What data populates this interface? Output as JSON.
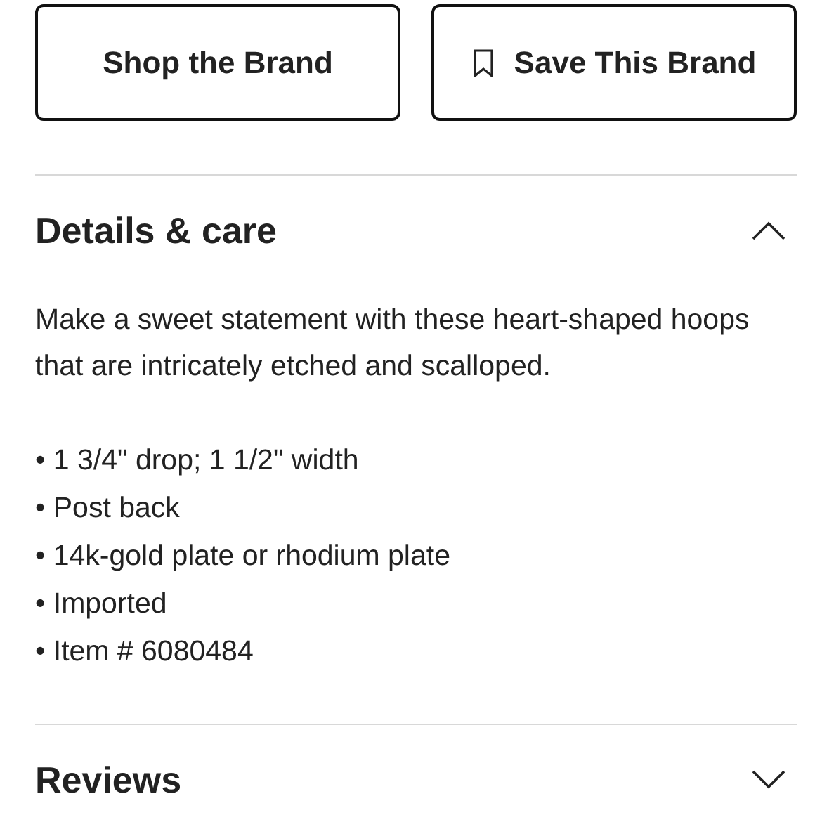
{
  "buttons": [
    {
      "label": "Shop the Brand",
      "kind": "plain"
    },
    {
      "label": "Save This Brand",
      "kind": "bookmark"
    }
  ],
  "sections": [
    {
      "title": "Details & care",
      "expanded": true,
      "description": "Make a sweet statement with these heart-shaped hoops that are intricately etched and scalloped.",
      "bullets": [
        "• 1 3/4\" drop; 1 1/2\" width",
        "• Post back",
        "• 14k-gold plate or rhodium plate",
        "• Imported",
        "• Item # 6080484"
      ]
    },
    {
      "title": "Reviews",
      "expanded": false
    }
  ]
}
